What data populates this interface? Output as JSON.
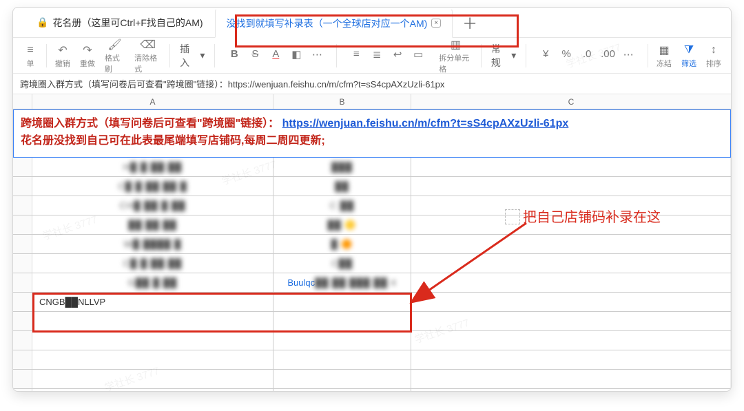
{
  "tabs": {
    "first": "花名册（这里可Ctrl+F找自己的AM)",
    "second": "没找到就填写补录表（一个全球店对应一个AM)"
  },
  "toolbar": {
    "undo": "撤销",
    "redo": "重做",
    "paintfmt": "格式刷",
    "clearfmt": "清除格式",
    "insert": "插入",
    "normal": "常规",
    "splitcell": "拆分单元格",
    "freeze": "冻结",
    "filter": "筛选",
    "sort": "排序"
  },
  "formula_bar": "跨境圈入群方式（填写问卷后可查看\"跨境圈\"链接）：https://wenjuan.feishu.cn/m/cfm?t=sS4cpAXzUzli-61px",
  "columns": {
    "A": "A",
    "B": "B",
    "C": "C"
  },
  "merged_header": {
    "line1_pre": "跨境圈入群方式（填写问卷后可查看\"跨境圈\"链接）：",
    "line1_link": "https://wenjuan.feishu.cn/m/cfm?t=sS4cpAXzUzli-61px",
    "line2": "花名册没找到自己可在此表最尾端填写店铺码,每周二周四更新;"
  },
  "rows": [
    {
      "a": "H█ █ ██ ██",
      "b": "███"
    },
    {
      "a": "C█ █ ██ ██ █",
      "b": "██"
    },
    {
      "a": "CH█ ██ █ ██",
      "b": "C ██"
    },
    {
      "a": "██ ██ ██",
      "b": "██ 🟡"
    },
    {
      "a": "W█ ████ █",
      "b": "█ 🟠"
    },
    {
      "a": "C█ █ ██ ██",
      "b": "C██"
    },
    {
      "a": "G██ █ ██",
      "b_prefix": "Buulqc",
      "b": "██ ██ ███ ██ 4"
    },
    {
      "a": "CNGB██NLLVP",
      "b": ""
    },
    {
      "a": "",
      "b": ""
    }
  ],
  "annotation": "把自己店铺码补录在这",
  "watermark": "学社长 3777"
}
